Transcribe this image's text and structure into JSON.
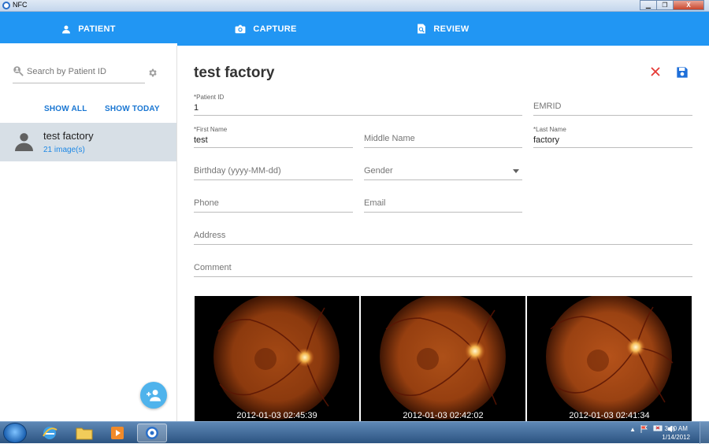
{
  "window": {
    "title": "NFC",
    "controls": {
      "minimize": "▁",
      "maximize": "❐",
      "close": "X"
    }
  },
  "tabs": [
    {
      "label": "PATIENT",
      "icon": "person-icon",
      "active": true
    },
    {
      "label": "CAPTURE",
      "icon": "camera-icon",
      "active": false
    },
    {
      "label": "REVIEW",
      "icon": "review-icon",
      "active": false
    }
  ],
  "sidebar": {
    "search": {
      "placeholder": "Search by Patient ID",
      "value": ""
    },
    "filters": {
      "show_all": "SHOW ALL",
      "show_today": "SHOW TODAY"
    },
    "patients": [
      {
        "name": "test factory",
        "images": "21 image(s)"
      }
    ]
  },
  "patient": {
    "title": "test factory",
    "fields": {
      "patient_id": {
        "label": "*Patient ID",
        "value": "1"
      },
      "emrid": {
        "placeholder": "EMRID"
      },
      "first_name": {
        "label": "*First Name",
        "value": "test"
      },
      "middle_name": {
        "placeholder": "Middle Name"
      },
      "last_name": {
        "label": "*Last Name",
        "value": "factory"
      },
      "birthday": {
        "placeholder": "Birthday (yyyy-MM-dd)"
      },
      "gender": {
        "placeholder": "Gender"
      },
      "phone": {
        "placeholder": "Phone"
      },
      "email": {
        "placeholder": "Email"
      },
      "address": {
        "placeholder": "Address"
      },
      "comment": {
        "placeholder": "Comment"
      }
    },
    "images": [
      {
        "timestamp": "2012-01-03 02:45:39"
      },
      {
        "timestamp": "2012-01-03 02:42:02"
      },
      {
        "timestamp": "2012-01-03 02:41:34"
      }
    ]
  },
  "taskbar": {
    "time": "3:00 AM",
    "date": "1/14/2012"
  },
  "colors": {
    "accent": "#2196f3",
    "close_icon": "#e53935",
    "save_icon": "#1e6fd9",
    "link": "#1976d2"
  }
}
